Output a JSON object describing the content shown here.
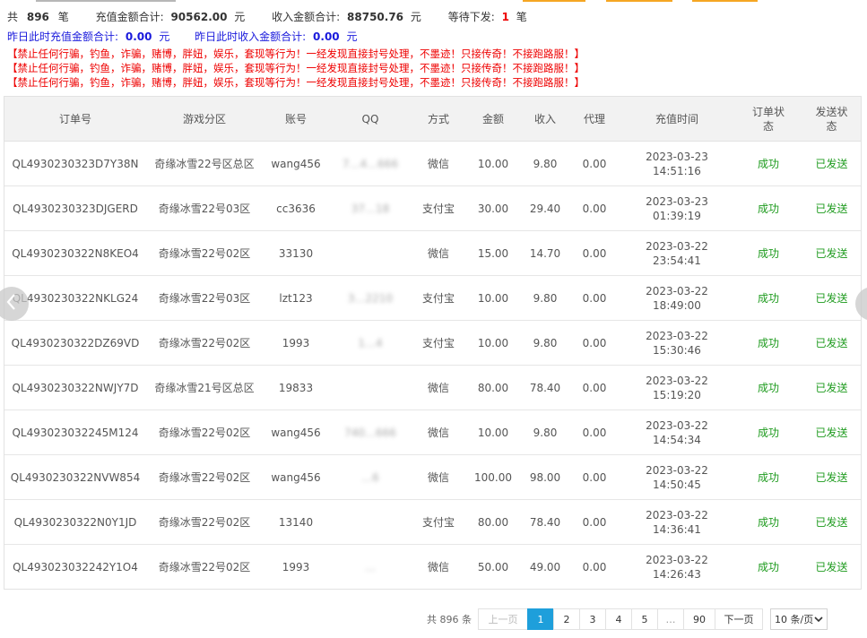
{
  "summary": {
    "total_prefix": "共",
    "total_count": "896",
    "total_unit": "笔",
    "recharge_label": "充值金额合计:",
    "recharge_total": "90562.00",
    "recharge_unit": "元",
    "income_label": "收入金额合计:",
    "income_total": "88750.76",
    "income_unit": "元",
    "pending_label": "等待下发:",
    "pending_count": "1",
    "pending_unit": "笔"
  },
  "yesterday": {
    "recharge_label": "昨日此时充值金额合计:",
    "recharge_value": "0.00",
    "recharge_unit": "元",
    "income_label": "昨日此时收入金额合计:",
    "income_value": "0.00",
    "income_unit": "元"
  },
  "warnings": [
    "【禁止任何行骗，钓鱼，诈骗，赌博，胖妞，娱乐，套现等行为！一经发现直接封号处理，不墨迹！只接传奇！不接跑路服！】",
    "【禁止任何行骗，钓鱼，诈骗，赌博，胖妞，娱乐，套现等行为！一经发现直接封号处理，不墨迹！只接传奇！不接跑路服！】",
    "【禁止任何行骗，钓鱼，诈骗，赌博，胖妞，娱乐，套现等行为！一经发现直接封号处理，不墨迹！只接传奇！不接跑路服！】"
  ],
  "table": {
    "headers": [
      "订单号",
      "游戏分区",
      "账号",
      "QQ",
      "方式",
      "金额",
      "收入",
      "代理",
      "充值时间",
      "订单状态",
      "发送状态"
    ],
    "rows": [
      {
        "order": "QL4930230323D7Y38N",
        "zone": "奇缘冰雪22号区总区",
        "account": "wang456",
        "qq": "7…4…666",
        "method": "微信",
        "amount": "10.00",
        "income": "9.80",
        "agent": "0.00",
        "date": "2023-03-23",
        "time": "14:51:16",
        "status": "成功",
        "sent": "已发送"
      },
      {
        "order": "QL4930230323DJGERD",
        "zone": "奇缘冰雪22号03区",
        "account": "cc3636",
        "qq": "37…18",
        "method": "支付宝",
        "amount": "30.00",
        "income": "29.40",
        "agent": "0.00",
        "date": "2023-03-23",
        "time": "01:39:19",
        "status": "成功",
        "sent": "已发送"
      },
      {
        "order": "QL4930230322N8KEO4",
        "zone": "奇缘冰雪22号02区",
        "account": "33130",
        "qq": "",
        "method": "微信",
        "amount": "15.00",
        "income": "14.70",
        "agent": "0.00",
        "date": "2023-03-22",
        "time": "23:54:41",
        "status": "成功",
        "sent": "已发送"
      },
      {
        "order": "QL4930230322NKLG24",
        "zone": "奇缘冰雪22号03区",
        "account": "lzt123",
        "qq": "3…2210",
        "method": "支付宝",
        "amount": "10.00",
        "income": "9.80",
        "agent": "0.00",
        "date": "2023-03-22",
        "time": "18:49:00",
        "status": "成功",
        "sent": "已发送"
      },
      {
        "order": "QL4930230322DZ69VD",
        "zone": "奇缘冰雪22号02区",
        "account": "1993",
        "qq": "1…4",
        "method": "支付宝",
        "amount": "10.00",
        "income": "9.80",
        "agent": "0.00",
        "date": "2023-03-22",
        "time": "15:30:46",
        "status": "成功",
        "sent": "已发送"
      },
      {
        "order": "QL4930230322NWJY7D",
        "zone": "奇缘冰雪21号区总区",
        "account": "19833",
        "qq": "",
        "method": "微信",
        "amount": "80.00",
        "income": "78.40",
        "agent": "0.00",
        "date": "2023-03-22",
        "time": "15:19:20",
        "status": "成功",
        "sent": "已发送"
      },
      {
        "order": "QL493023032245M124",
        "zone": "奇缘冰雪22号02区",
        "account": "wang456",
        "qq": "740…666",
        "method": "微信",
        "amount": "10.00",
        "income": "9.80",
        "agent": "0.00",
        "date": "2023-03-22",
        "time": "14:54:34",
        "status": "成功",
        "sent": "已发送"
      },
      {
        "order": "QL4930230322NVW854",
        "zone": "奇缘冰雪22号02区",
        "account": "wang456",
        "qq": "…6",
        "method": "微信",
        "amount": "100.00",
        "income": "98.00",
        "agent": "0.00",
        "date": "2023-03-22",
        "time": "14:50:45",
        "status": "成功",
        "sent": "已发送"
      },
      {
        "order": "QL4930230322N0Y1JD",
        "zone": "奇缘冰雪22号02区",
        "account": "13140",
        "qq": "",
        "method": "支付宝",
        "amount": "80.00",
        "income": "78.40",
        "agent": "0.00",
        "date": "2023-03-22",
        "time": "14:36:41",
        "status": "成功",
        "sent": "已发送"
      },
      {
        "order": "QL493023032242Y1O4",
        "zone": "奇缘冰雪22号02区",
        "account": "1993",
        "qq": "…",
        "method": "微信",
        "amount": "50.00",
        "income": "49.00",
        "agent": "0.00",
        "date": "2023-03-22",
        "time": "14:26:43",
        "status": "成功",
        "sent": "已发送"
      }
    ]
  },
  "pagination": {
    "total_text": "共 896 条",
    "prev": "上一页",
    "pages": [
      "1",
      "2",
      "3",
      "4",
      "5"
    ],
    "ellipsis": "…",
    "last": "90",
    "next": "下一页",
    "page_size": "10 条/页",
    "current": "1"
  },
  "colors": {
    "accent": "#1e9fdb",
    "warning": "#ee0000",
    "success": "#1e9b1e",
    "yesterday_text": "#1a1adc",
    "topbar_orange": "#f5a623"
  },
  "icons": {
    "prev_arrow": "chevron-left-icon",
    "next_arrow": "chevron-right-icon",
    "select_caret": "chevron-down-icon"
  }
}
